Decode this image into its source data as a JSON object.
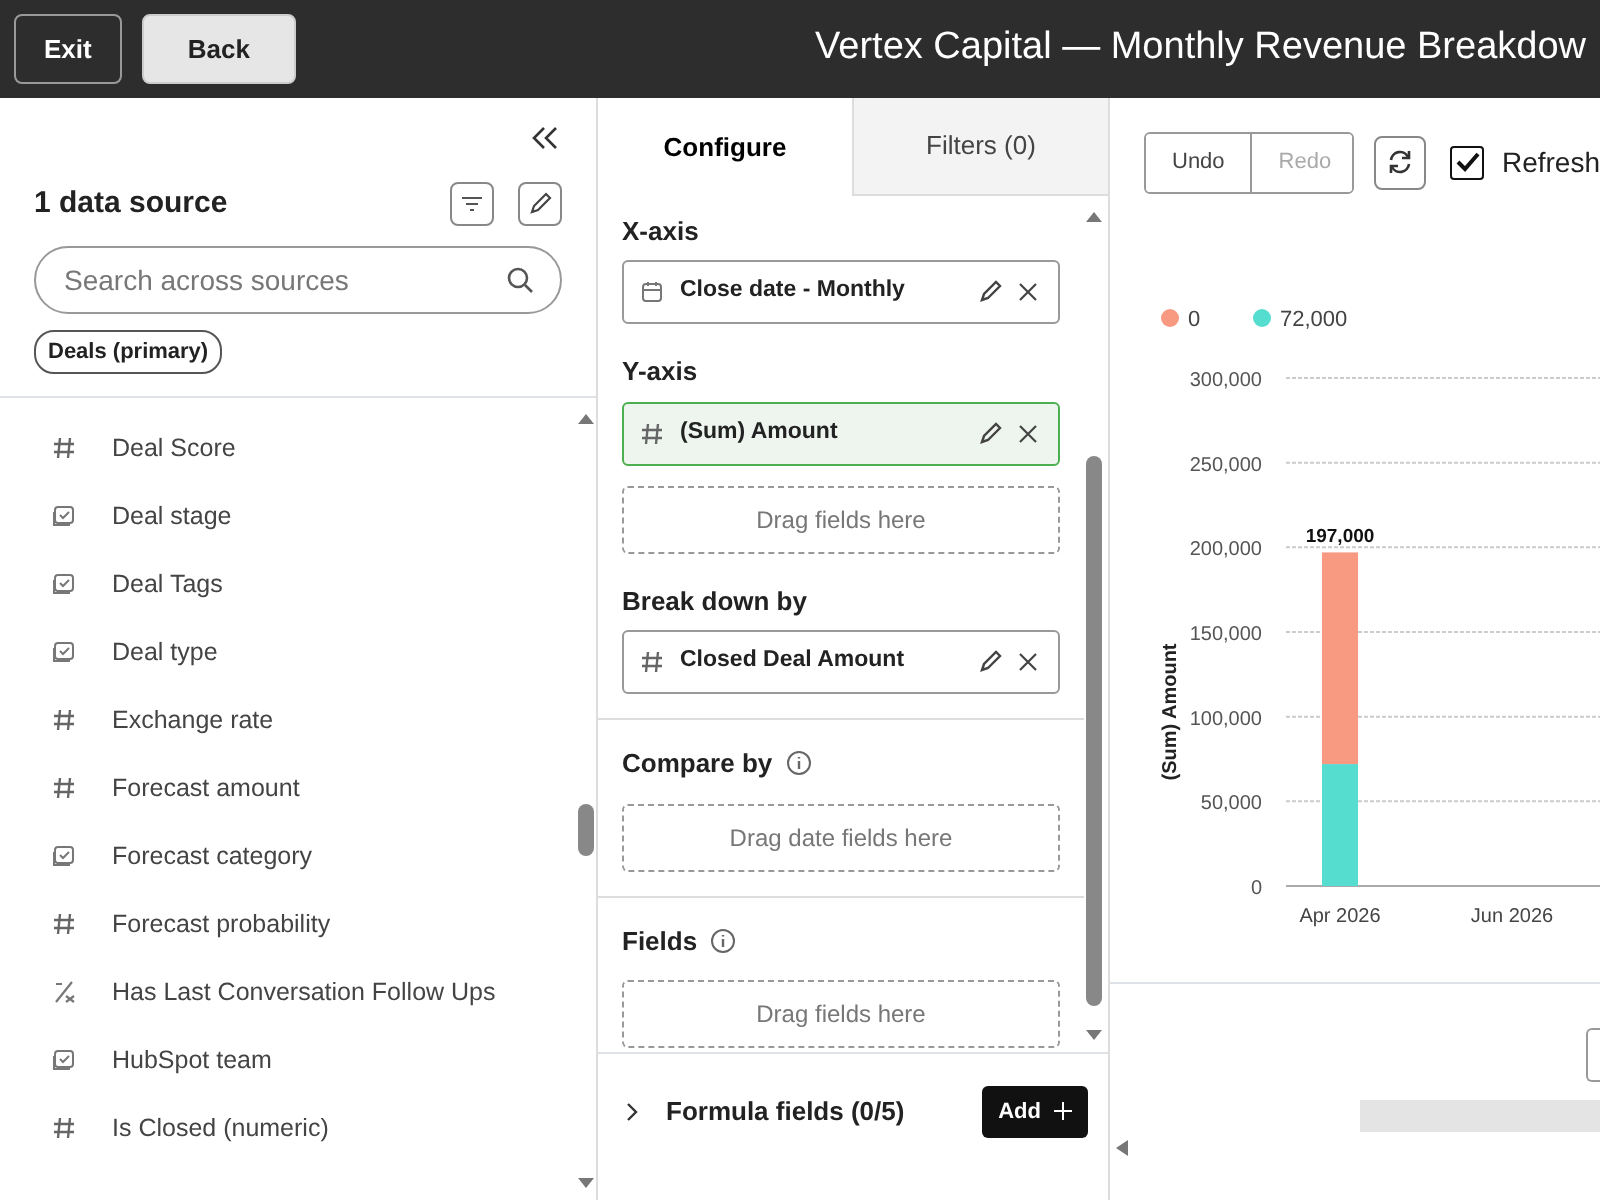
{
  "top_bar": {
    "buttons": [
      {
        "label": "Exit",
        "kind": "dark"
      },
      {
        "label": "Back",
        "kind": "light"
      }
    ],
    "title": "Vertex Capital — Monthly Revenue Breakdow"
  },
  "sidebar": {
    "title": "1 data source",
    "search": {
      "placeholder": "Search across sources"
    },
    "chip": "Deals (primary)",
    "items": [
      {
        "label": "Deal Score",
        "kind": "number"
      },
      {
        "label": "Deal stage",
        "kind": "enum"
      },
      {
        "label": "Deal Tags",
        "kind": "enum"
      },
      {
        "label": "Deal type",
        "kind": "enum"
      },
      {
        "label": "Exchange rate",
        "kind": "number"
      },
      {
        "label": "Forecast amount",
        "kind": "number"
      },
      {
        "label": "Forecast category",
        "kind": "enum"
      },
      {
        "label": "Forecast probability",
        "kind": "number"
      },
      {
        "label": "Has Last Conversation Follow Ups",
        "kind": "formula"
      },
      {
        "label": "HubSpot team",
        "kind": "enum"
      },
      {
        "label": "Is Closed (numeric)",
        "kind": "number"
      }
    ]
  },
  "tabs": [
    {
      "label": "Configure",
      "selected": true
    },
    {
      "label": "Filters (0)",
      "selected": false
    }
  ],
  "config_groups": [
    {
      "sections": [
        {
          "title": "X-axis",
          "fields": [
            {
              "label": "Close date - Monthly",
              "kind": "date",
              "selected": false
            }
          ]
        },
        {
          "title": "Y-axis",
          "fields": [
            {
              "label": "(Sum) Amount",
              "kind": "number",
              "selected": true
            }
          ],
          "dropzone": "Drag fields here"
        },
        {
          "title": "Break down by",
          "fields": [
            {
              "label": "Closed Deal Amount",
              "kind": "number",
              "selected": false
            }
          ]
        }
      ]
    },
    {
      "sections": [
        {
          "title": "Compare by",
          "info": true,
          "dropzone": "Drag date fields here"
        }
      ]
    },
    {
      "sections": [
        {
          "title": "Fields",
          "info": true,
          "dropzone": "Drag fields here"
        }
      ]
    }
  ],
  "formula_fields": {
    "label": "Formula fields (0/5)",
    "button": "Add"
  },
  "toolbar": {
    "undo": {
      "label": "Undo",
      "disabled": false
    },
    "redo": {
      "label": "Redo",
      "disabled": true
    },
    "refresh_checkbox": {
      "label": "Refresh",
      "checked": true
    }
  },
  "chart": {
    "chart_data": {
      "type": "bar",
      "stacked": true,
      "ylabel": "(Sum) Amount",
      "categories": [
        "Apr 2026",
        "Jun 2026"
      ],
      "series": [
        {
          "name": "0",
          "color": "#f89a82",
          "values": [
            125000,
            null
          ]
        },
        {
          "name": "72,000",
          "color": "#55ddd0",
          "values": [
            72000,
            null
          ]
        }
      ],
      "ylim": [
        0,
        300000
      ],
      "yticks": [
        {
          "value": 0,
          "label": "0"
        },
        {
          "value": 50000,
          "label": "50,000"
        },
        {
          "value": 100000,
          "label": "100,000"
        },
        {
          "value": 150000,
          "label": "150,000"
        },
        {
          "value": 200000,
          "label": "200,000"
        },
        {
          "value": 250000,
          "label": "250,000"
        },
        {
          "value": 300000,
          "label": "300,000"
        }
      ],
      "grid": true,
      "legend": true,
      "annotations": [
        {
          "x": "Apr 2026",
          "y": 197000,
          "text": "197,000"
        }
      ]
    }
  }
}
